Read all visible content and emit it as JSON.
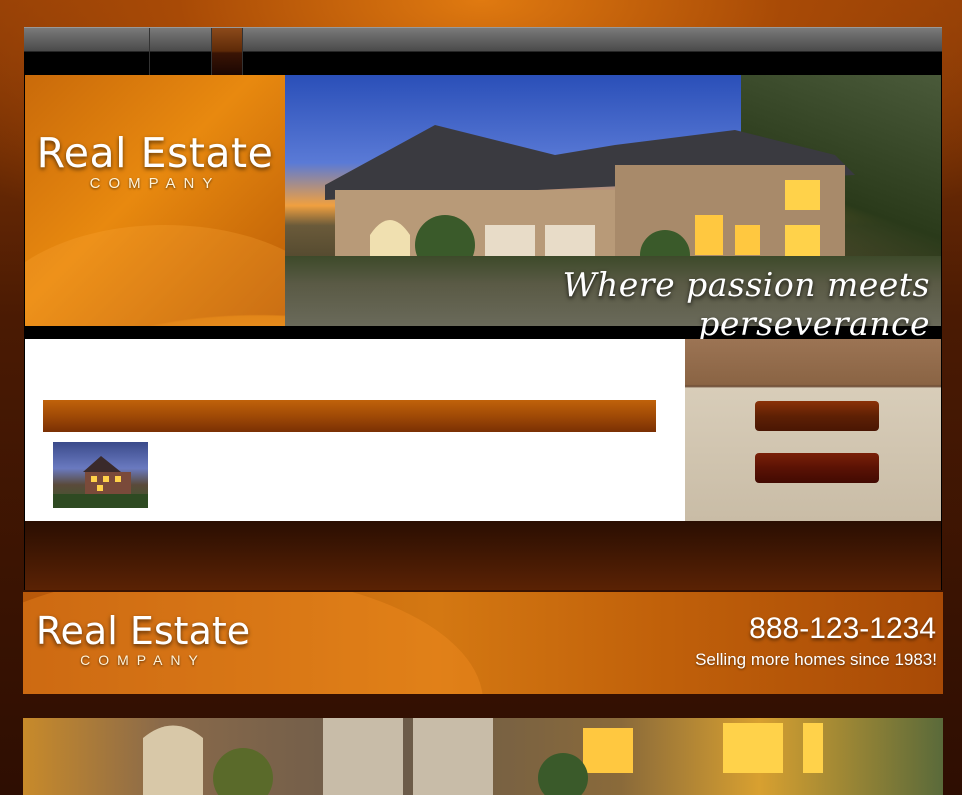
{
  "brand": {
    "title": "Real Estate",
    "subtitle": "COMPANY"
  },
  "hero": {
    "tagline": "Where passion meets perseverance"
  },
  "footer": {
    "title": "Real Estate",
    "subtitle": "COMPANY",
    "phone": "888-123-1234",
    "slogan": "Selling more homes since 1983!"
  },
  "colors": {
    "accent": "#d47812",
    "dark_brown": "#5e2004",
    "sidebar_bg": "#c9bca6"
  },
  "icons": {
    "hero": "house-photo",
    "thumbnail": "house-photo",
    "strip": "house-photo"
  }
}
